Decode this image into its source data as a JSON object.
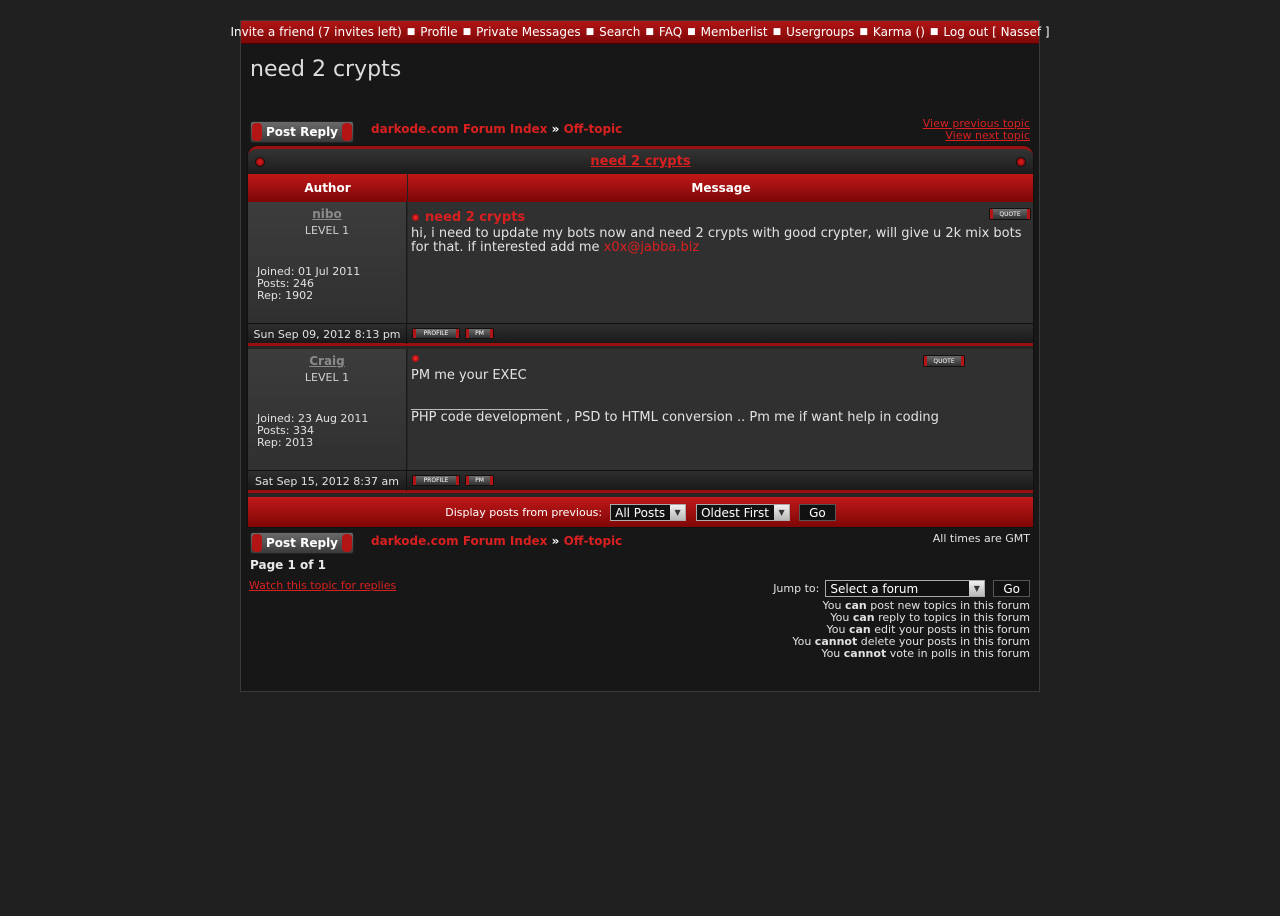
{
  "topnav": {
    "items": [
      "Invite a friend (7 invites left)",
      "Profile",
      "Private Messages",
      "Search",
      "FAQ",
      "Memberlist",
      "Usergroups",
      "Karma ()",
      "Log out [ Nassef ]"
    ]
  },
  "topic": {
    "title": "need 2 crypts"
  },
  "actions": {
    "post_reply": "Post Reply"
  },
  "breadcrumb": {
    "forum_index": "darkode.com Forum Index",
    "separator": "»",
    "subforum": "Off-topic"
  },
  "nav": {
    "prev_topic": "View previous topic",
    "next_topic": "View next topic"
  },
  "table": {
    "caption": "need 2 crypts",
    "col_author": "Author",
    "col_message": "Message"
  },
  "posts": [
    {
      "author": "nibo",
      "level": "LEVEL 1",
      "joined": "Joined: 01 Jul 2011",
      "posts": "Posts: 246",
      "rep": "Rep: 1902",
      "subject": "need 2 crypts",
      "body": "hi, i need to update my bots now and need 2 crypts with good crypter, will give u 2k mix bots for that. if interested add me ",
      "link": "x0x@jabba.biz",
      "date": "Sun Sep 09, 2012 8:13 pm"
    },
    {
      "author": "Craig",
      "level": "LEVEL 1",
      "joined": "Joined: 23 Aug 2011",
      "posts": "Posts: 334",
      "rep": "Rep: 2013",
      "subject": "",
      "body": "PM me your EXEC",
      "signature": "PHP code development , PSD to HTML conversion .. Pm me if want help in coding",
      "date": "Sat Sep 15, 2012 8:37 am"
    }
  ],
  "buttons": {
    "quote": "QUOTE",
    "profile": "PROFILE",
    "pm": "PM",
    "go": "Go"
  },
  "display": {
    "label": "Display posts from previous:",
    "posts_value": "All Posts",
    "order_value": "Oldest First"
  },
  "footer": {
    "gmt": "All times are GMT",
    "page": "Page 1 of 1",
    "watch": "Watch this topic for replies",
    "jump_label": "Jump to:",
    "jump_value": "Select a forum"
  },
  "permissions": [
    {
      "pre": "You ",
      "strong": "can",
      "post": " post new topics in this forum"
    },
    {
      "pre": "You ",
      "strong": "can",
      "post": " reply to topics in this forum"
    },
    {
      "pre": "You ",
      "strong": "can",
      "post": " edit your posts in this forum"
    },
    {
      "pre": "You ",
      "strong": "cannot",
      "post": " delete your posts in this forum"
    },
    {
      "pre": "You ",
      "strong": "cannot",
      "post": " vote in polls in this forum"
    }
  ],
  "colors": {
    "accent": "#d92020",
    "bar": "#a01010",
    "bg": "#202020"
  },
  "icons": {
    "dropdown": "chevron-down-icon",
    "bullet": "red-dot-icon"
  }
}
